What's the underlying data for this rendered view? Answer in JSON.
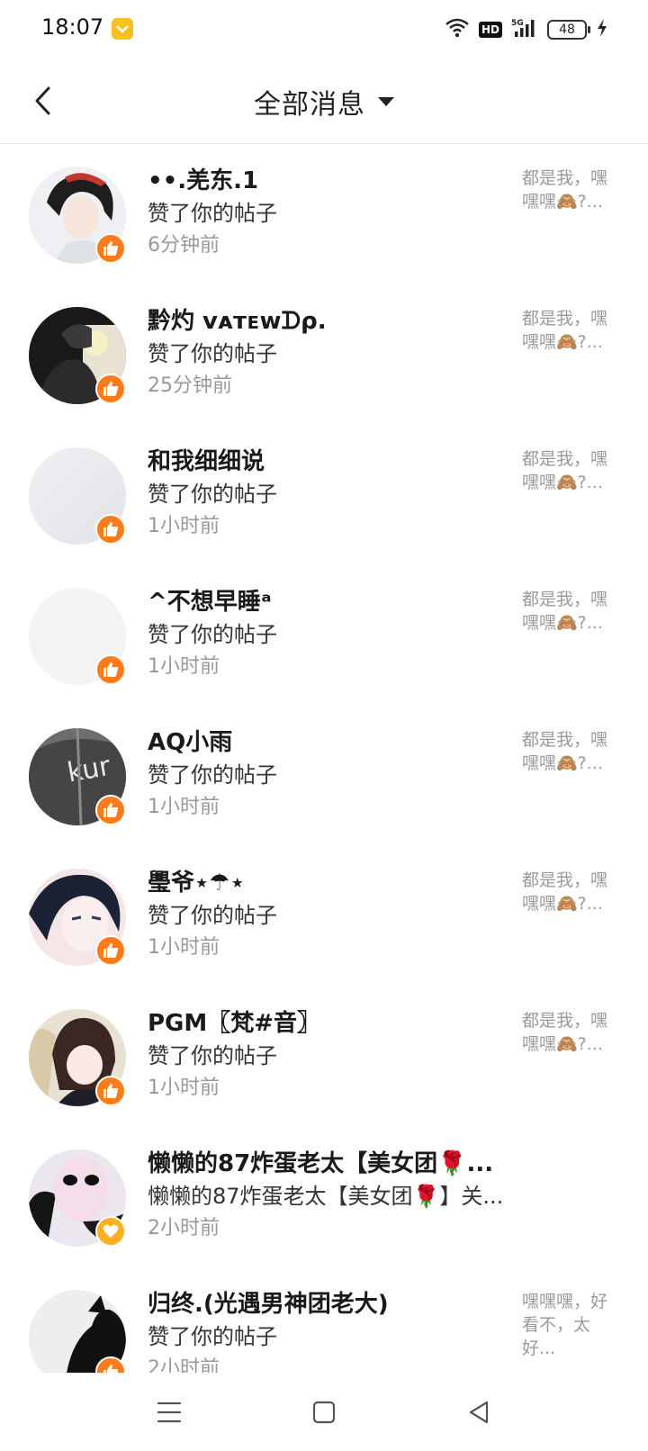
{
  "status_bar": {
    "time": "18:07",
    "battery": "48",
    "hd": "HD",
    "network": "5G",
    "icons": [
      "wifi-icon",
      "signal-icon",
      "charging-icon"
    ]
  },
  "header": {
    "title": "全部消息",
    "back_icon": "chevron-left-icon",
    "dropdown_icon": "caret-down-icon"
  },
  "colors": {
    "like_badge": "#ff7a1a",
    "heart_badge": "#ffb020",
    "preview_text": "#9a9a9a",
    "time_text": "#999999"
  },
  "messages": [
    {
      "name": "••.羌东.1",
      "action": "赞了你的帖子",
      "time": "6分钟前",
      "preview": "都是我，嘿嘿嘿🙈?...",
      "badge": "like"
    },
    {
      "name": "黔灼 ᴠᴀᴛᴇᴡᗪρ.",
      "action": "赞了你的帖子",
      "time": "25分钟前",
      "preview": "都是我，嘿嘿嘿🙈?...",
      "badge": "like"
    },
    {
      "name": "和我细细说",
      "action": "赞了你的帖子",
      "time": "1小时前",
      "preview": "都是我，嘿嘿嘿🙈?...",
      "badge": "like"
    },
    {
      "name": "^不想早睡ᵃ",
      "action": "赞了你的帖子",
      "time": "1小时前",
      "preview": "都是我，嘿嘿嘿🙈?...",
      "badge": "like"
    },
    {
      "name": "AQ小雨",
      "action": "赞了你的帖子",
      "time": "1小时前",
      "preview": "都是我，嘿嘿嘿🙈?...",
      "badge": "like"
    },
    {
      "name": "璺爷⋆☂⋆",
      "action": "赞了你的帖子",
      "time": "1小时前",
      "preview": "都是我，嘿嘿嘿🙈?...",
      "badge": "like"
    },
    {
      "name": "PGM〖梵#音〗",
      "action": "赞了你的帖子",
      "time": "1小时前",
      "preview": "都是我，嘿嘿嘿🙈?...",
      "badge": "like"
    },
    {
      "name": "懒懒的87炸蛋老太【美女团🌹...",
      "action": "懒懒的87炸蛋老太【美女团🌹】关...",
      "time": "2小时前",
      "preview": "",
      "badge": "heart"
    },
    {
      "name": "归终.(光遇男神团老大)",
      "action": "赞了你的帖子",
      "time": "2小时前",
      "preview": "嘿嘿嘿，好看不，太好...",
      "badge": "like"
    }
  ],
  "bottom_nav": {
    "icons": [
      "menu-icon",
      "home-square-icon",
      "back-triangle-icon"
    ]
  }
}
